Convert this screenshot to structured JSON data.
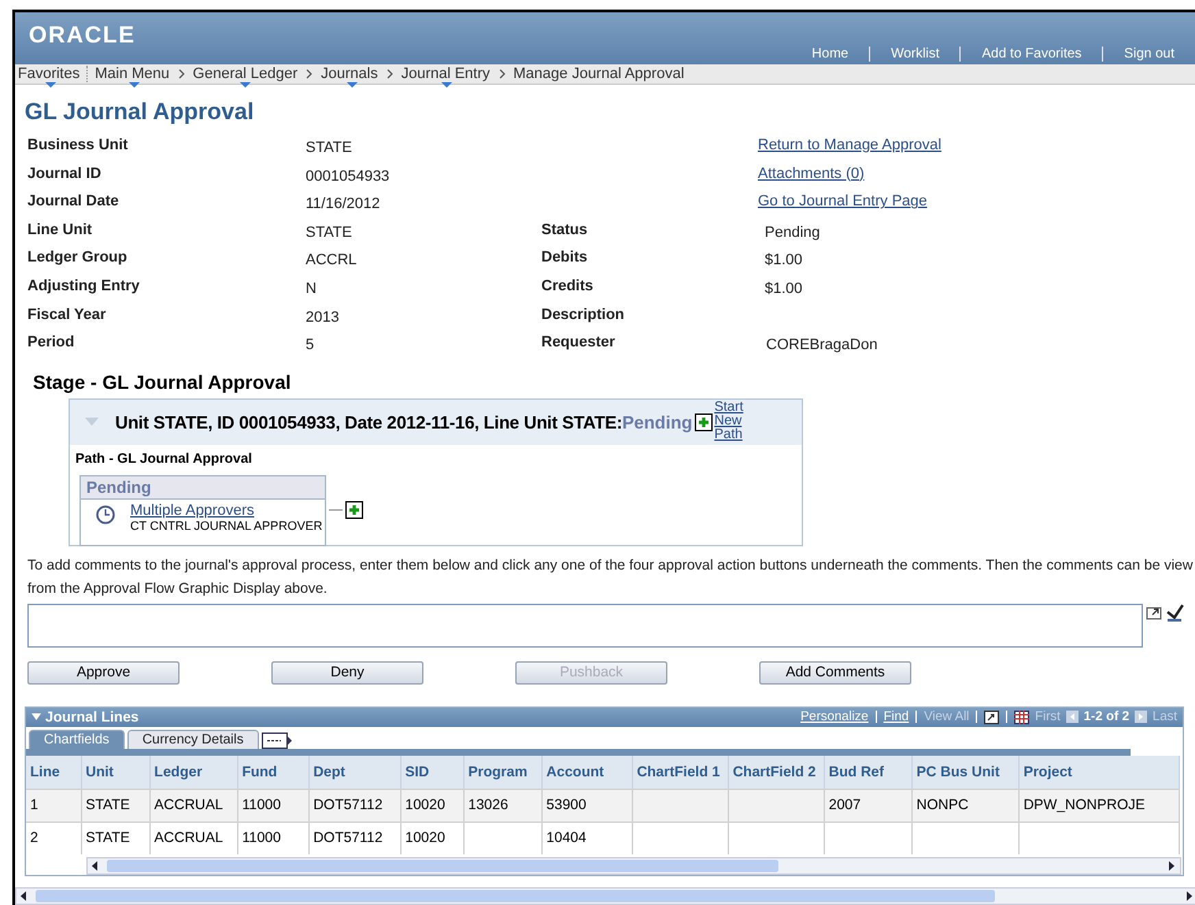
{
  "header": {
    "logo": "ORACLE",
    "links": [
      "Home",
      "Worklist",
      "Add to Favorites",
      "Sign out"
    ]
  },
  "breadcrumbs": [
    {
      "label": "Favorites",
      "menu": true
    },
    {
      "label": "Main Menu",
      "menu": true
    },
    {
      "label": "General Ledger",
      "menu": true
    },
    {
      "label": "Journals",
      "menu": true
    },
    {
      "label": "Journal Entry",
      "menu": true
    },
    {
      "label": "Manage Journal Approval",
      "menu": false
    }
  ],
  "title": "GL Journal Approval",
  "fields_left": [
    {
      "label": "Business Unit",
      "value": "STATE"
    },
    {
      "label": "Journal ID",
      "value": "0001054933"
    },
    {
      "label": "Journal Date",
      "value": "11/16/2012"
    },
    {
      "label": "Line Unit",
      "value": "STATE"
    },
    {
      "label": "Ledger Group",
      "value": "ACCRL"
    },
    {
      "label": "Adjusting Entry",
      "value": "N"
    },
    {
      "label": "Fiscal Year",
      "value": "2013"
    },
    {
      "label": "Period",
      "value": "5"
    }
  ],
  "links": [
    "Return to Manage Approval",
    "Attachments (0)",
    "Go to Journal Entry Page"
  ],
  "fields_right": [
    {
      "label": "Status",
      "value": "Pending"
    },
    {
      "label": "Debits",
      "value": "$1.00"
    },
    {
      "label": "Credits",
      "value": "$1.00"
    },
    {
      "label": "Description"
    },
    {
      "label": "Requester",
      "value": "COREBragaDon"
    }
  ],
  "stage": {
    "title": "Stage - GL Journal Approval",
    "header": "Unit STATE, ID 0001054933, Date 2012-11-16, Line Unit STATE:",
    "status": "Pending",
    "start_path_link": "Start New Path",
    "path_label": "Path - GL Journal Approval",
    "step": {
      "status": "Pending",
      "approver_link": "Multiple Approvers",
      "role": "CT CNTRL JOURNAL APPROVER"
    }
  },
  "instructions": "To add comments to the journal's approval process, enter them below and click any one of the four approval action buttons underneath the comments. Then the comments can be view",
  "instructions_2": "from the Approval Flow Graphic Display above.",
  "buttons": [
    {
      "label": "Approve",
      "disabled": false
    },
    {
      "label": "Deny",
      "disabled": false
    },
    {
      "label": "Pushback",
      "disabled": true
    },
    {
      "label": "Add Comments",
      "disabled": false
    }
  ],
  "grid": {
    "title": "Journal Lines",
    "tools": [
      {
        "label": "Personalize",
        "disabled": false
      },
      {
        "label": "Find",
        "disabled": false
      },
      {
        "label": "View All",
        "disabled": true
      }
    ],
    "first": "First",
    "range": "1-2 of 2",
    "last": "Last",
    "tabs": [
      {
        "label": "Chartfields",
        "selected": true
      },
      {
        "label": "Currency Details",
        "selected": false
      }
    ],
    "columns": [
      "Line",
      "Unit",
      "Ledger",
      "Fund",
      "Dept",
      "SID",
      "Program",
      "Account",
      "ChartField 1",
      "ChartField 2",
      "Bud Ref",
      "PC Bus Unit",
      "Project"
    ],
    "rows": [
      [
        "1",
        "STATE",
        "ACCRUAL",
        "11000",
        "DOT57112",
        "10020",
        "13026",
        "53900",
        "",
        "",
        "2007",
        "NONPC",
        "DPW_NONPROJE"
      ],
      [
        "2",
        "STATE",
        "ACCRUAL",
        "11000",
        "DOT57112",
        "10020",
        "",
        "10404",
        "",
        "",
        "",
        "",
        ""
      ]
    ]
  }
}
